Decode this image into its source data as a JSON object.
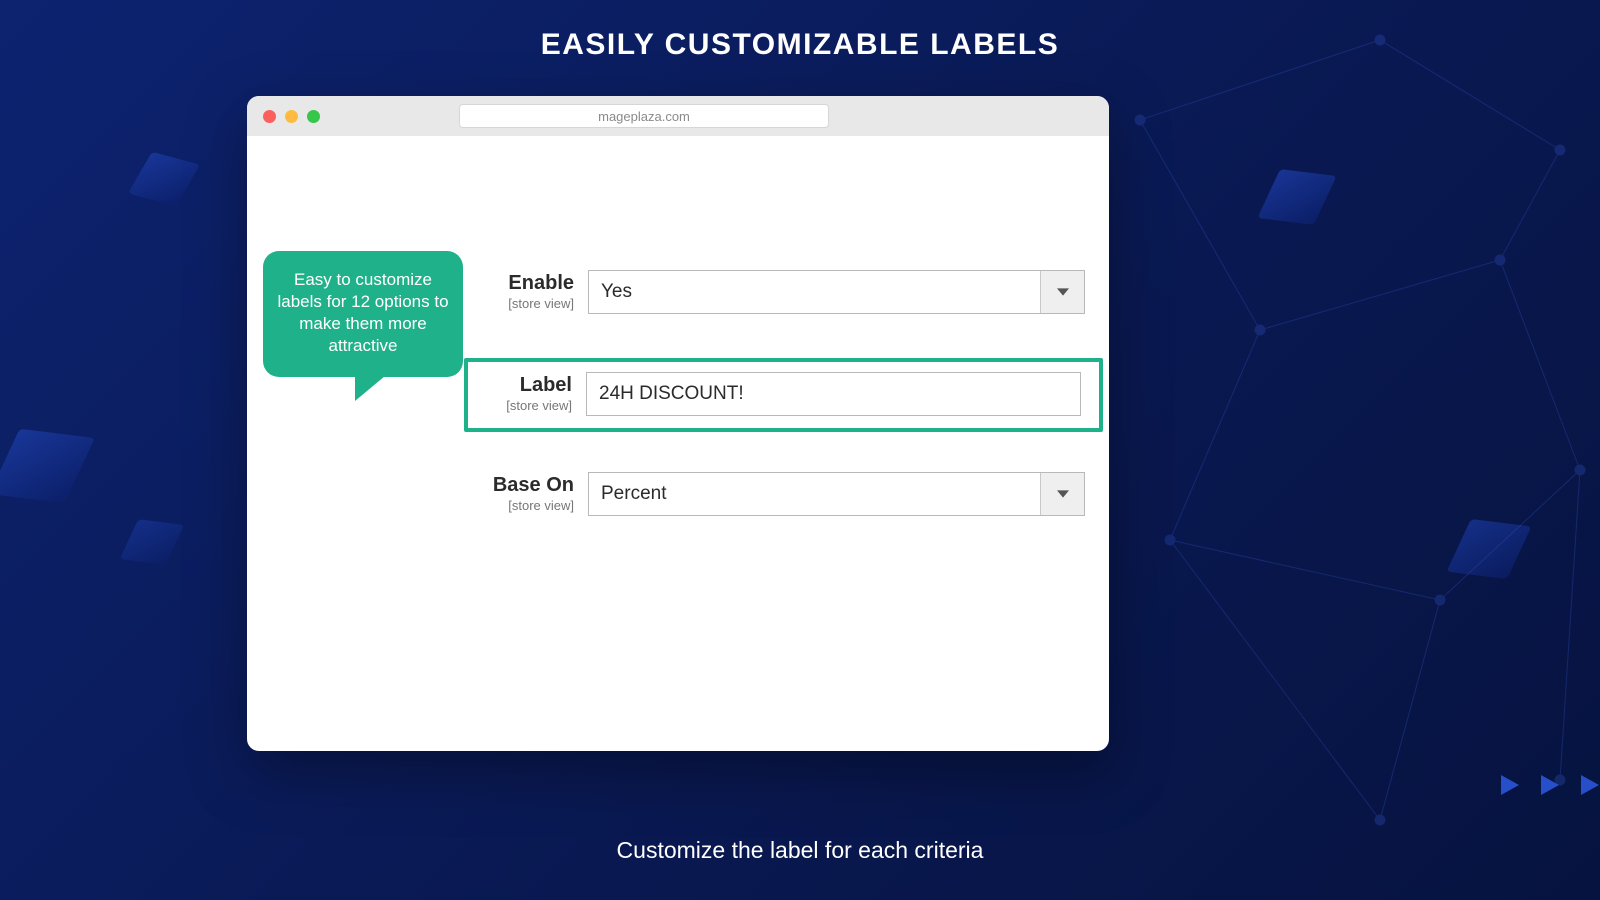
{
  "page": {
    "heading": "EASILY CUSTOMIZABLE LABELS",
    "subtitle": "Customize the label for each criteria"
  },
  "browser": {
    "url": "mageplaza.com"
  },
  "callout": {
    "text": "Easy to customize labels for 12 options to make them more attractive"
  },
  "form": {
    "enable": {
      "label": "Enable",
      "scope": "[store view]",
      "value": "Yes"
    },
    "label": {
      "label": "Label",
      "scope": "[store view]",
      "value": "24H DISCOUNT!"
    },
    "baseOn": {
      "label": "Base On",
      "scope": "[store view]",
      "value": "Percent"
    }
  },
  "colors": {
    "accent": "#1fb28a"
  }
}
